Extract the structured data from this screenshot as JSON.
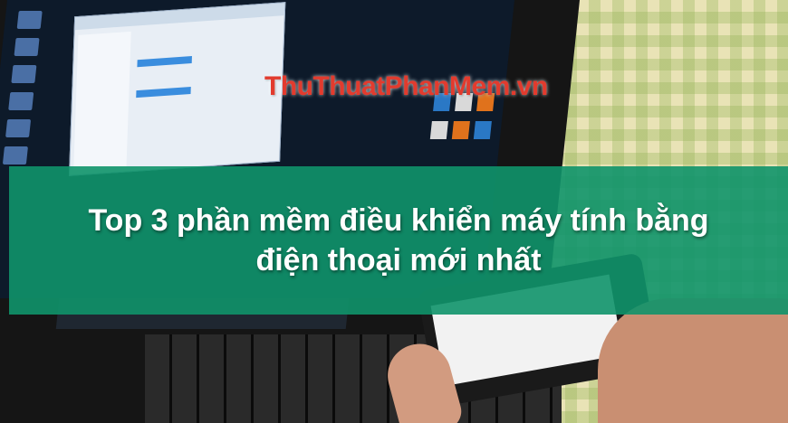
{
  "watermark": {
    "text": "ThuThuatPhanMem.vn",
    "color": "#e23b2e"
  },
  "title": {
    "line1": "Top 3 phần mềm điều khiển máy tính bằng",
    "line2": "điện thoại mới nhất"
  },
  "colors": {
    "band": "#0f946a",
    "title_text": "#ffffff"
  }
}
